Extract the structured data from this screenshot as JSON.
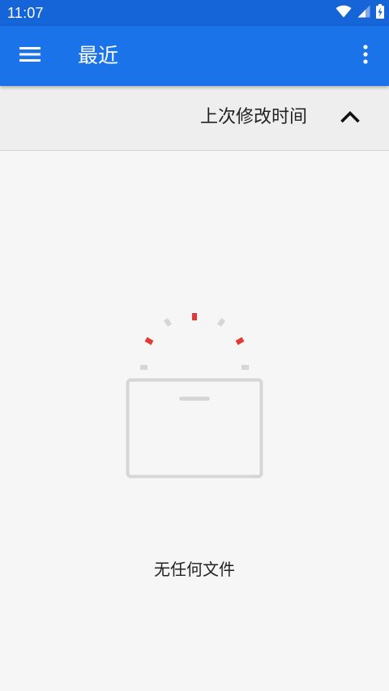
{
  "status_bar": {
    "time": "11:07",
    "icons": [
      "wifi-icon",
      "cellular-signal-icon",
      "battery-charging-icon"
    ]
  },
  "app_bar": {
    "menu_icon": "menu-icon",
    "title": "最近",
    "overflow_icon": "more-vert-icon",
    "color": "#1a73e8"
  },
  "sort_bar": {
    "label": "上次修改时间",
    "direction_icon": "chevron-up-icon"
  },
  "empty_state": {
    "illustration": "empty-folder-icon",
    "message": "无任何文件"
  },
  "colors": {
    "status_bar": "#1565d8",
    "app_bar": "#1a73e8",
    "background": "#f6f6f6",
    "sort_bar": "#eeeeee",
    "accent_red": "#e53935",
    "illustration_gray": "#d6d6d9"
  }
}
